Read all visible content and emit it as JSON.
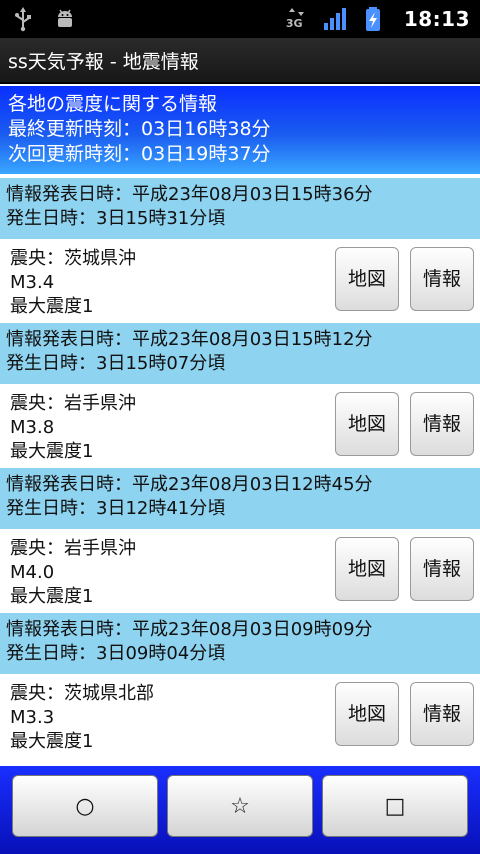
{
  "status_bar": {
    "time": "18:13",
    "network_label": "3G",
    "icons": [
      "usb-icon",
      "android-debug-icon",
      "network-3g-icon",
      "signal-icon",
      "battery-charging-icon"
    ]
  },
  "app": {
    "title": "ss天気予報 - 地震情報"
  },
  "header": {
    "line1": "各地の震度に関する情報",
    "line2": "最終更新時刻：03日16時38分",
    "line3": "次回更新時刻：03日19時37分"
  },
  "quakes": [
    {
      "announce": "情報発表日時：平成23年08月03日15時36分",
      "occur": "発生日時：3日15時31分頃",
      "epicenter": "震央：茨城県沖",
      "magnitude": "M3.4",
      "max_intensity": "最大震度1"
    },
    {
      "announce": "情報発表日時：平成23年08月03日15時12分",
      "occur": "発生日時：3日15時07分頃",
      "epicenter": "震央：岩手県沖",
      "magnitude": "M3.8",
      "max_intensity": "最大震度1"
    },
    {
      "announce": "情報発表日時：平成23年08月03日12時45分",
      "occur": "発生日時：3日12時41分頃",
      "epicenter": "震央：岩手県沖",
      "magnitude": "M4.0",
      "max_intensity": "最大震度1"
    },
    {
      "announce": "情報発表日時：平成23年08月03日09時09分",
      "occur": "発生日時：3日09時04分頃",
      "epicenter": "震央：茨城県北部",
      "magnitude": "M3.3",
      "max_intensity": "最大震度1"
    }
  ],
  "buttons": {
    "map": "地図",
    "info": "情報"
  },
  "bottom_bar": {
    "btn1": "○",
    "btn2": "☆",
    "btn3": "□"
  },
  "colors": {
    "header_blue": "#1a5cf0",
    "row_head": "#8ed3f0",
    "bottom_blue": "#0710b8"
  }
}
